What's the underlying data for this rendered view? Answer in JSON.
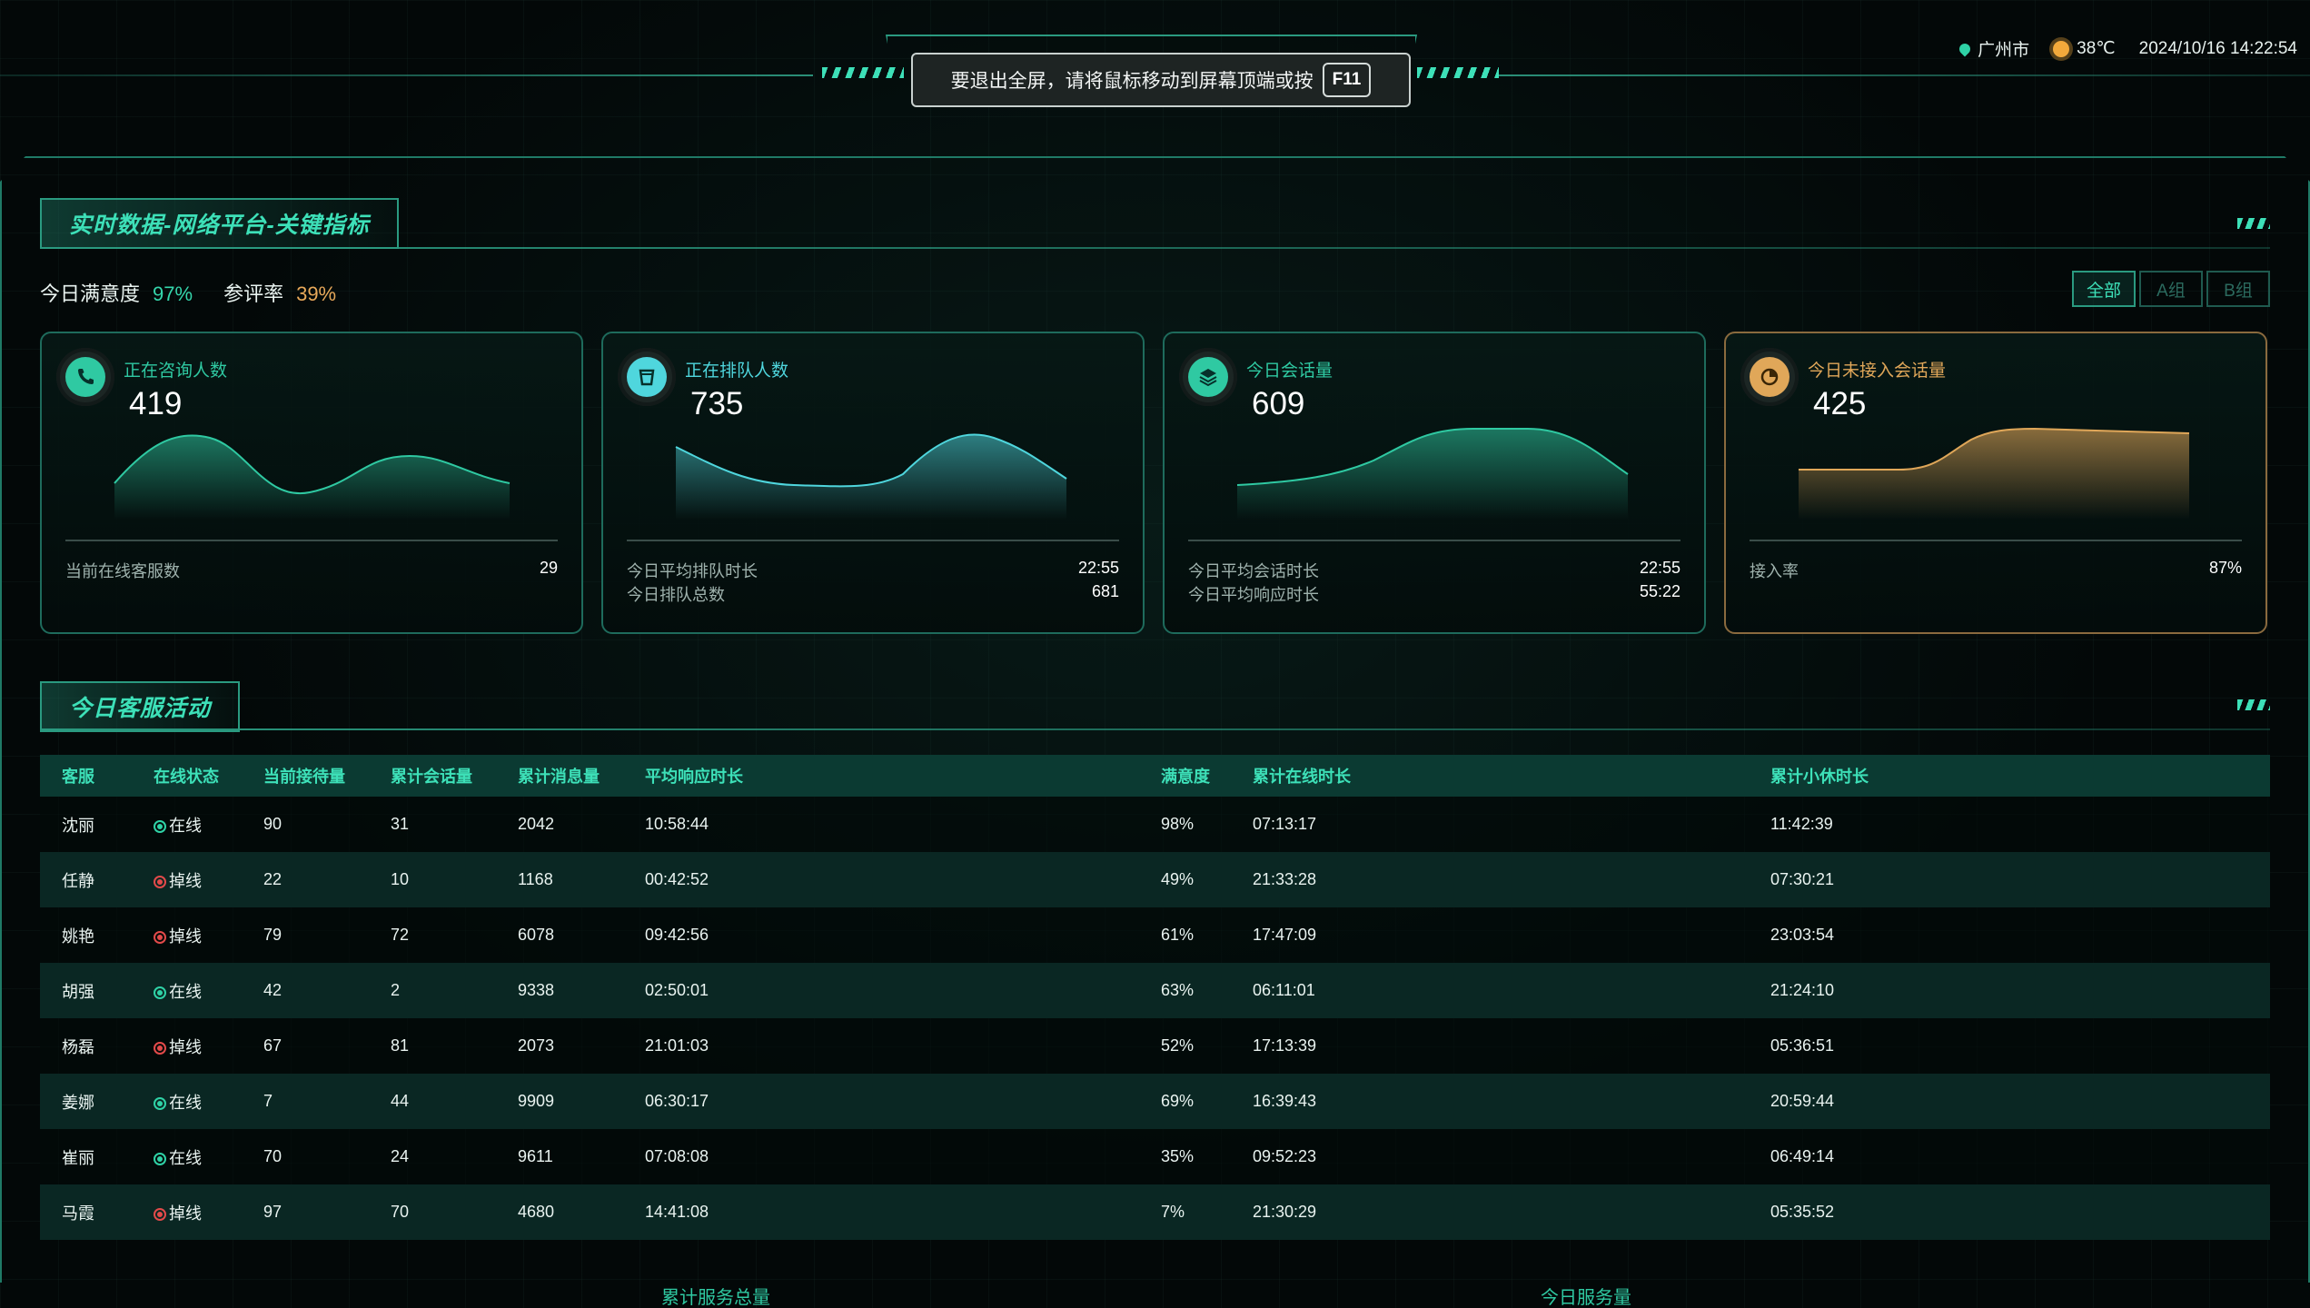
{
  "header": {
    "fullscreen_message": "要退出全屏，请将鼠标移动到屏幕顶端或按",
    "fullscreen_key": "F11",
    "location": "广州市",
    "temperature": "38℃",
    "datetime": "2024/10/16 14:22:54"
  },
  "section1": {
    "title": "实时数据-网络平台-关键指标",
    "satisfaction_label": "今日满意度",
    "satisfaction_value": "97%",
    "review_rate_label": "参评率",
    "review_rate_value": "39%",
    "filters": [
      "全部",
      "A组",
      "B组"
    ],
    "active_filter": "全部"
  },
  "cards": [
    {
      "label": "正在咨询人数",
      "value": "419",
      "accent": "#2fc9a2",
      "icon": "phone-icon",
      "rows": [
        {
          "label": "当前在线客服数",
          "value": "29"
        }
      ]
    },
    {
      "label": "正在排队人数",
      "value": "735",
      "accent": "#4fd6dd",
      "icon": "cup-icon",
      "rows": [
        {
          "label": "今日平均排队时长",
          "value": "22:55"
        },
        {
          "label": "今日排队总数",
          "value": "681"
        }
      ]
    },
    {
      "label": "今日会话量",
      "value": "609",
      "accent": "#2fc9a2",
      "icon": "layers-icon",
      "rows": [
        {
          "label": "今日平均会话时长",
          "value": "22:55"
        },
        {
          "label": "今日平均响应时长",
          "value": "55:22"
        }
      ]
    },
    {
      "label": "今日未接入会话量",
      "value": "425",
      "accent": "#e0a759",
      "icon": "pie-icon",
      "rows": [
        {
          "label": "接入率",
          "value": "87%"
        }
      ]
    }
  ],
  "section2": {
    "title": "今日客服活动",
    "columns": [
      "客服",
      "在线状态",
      "当前接待量",
      "累计会话量",
      "累计消息量",
      "平均响应时长",
      "满意度",
      "累计在线时长",
      "累计小休时长"
    ],
    "rows": [
      [
        "沈丽",
        "在线",
        "90",
        "31",
        "2042",
        "10:58:44",
        "98%",
        "07:13:17",
        "11:42:39"
      ],
      [
        "任静",
        "掉线",
        "22",
        "10",
        "1168",
        "00:42:52",
        "49%",
        "21:33:28",
        "07:30:21"
      ],
      [
        "姚艳",
        "掉线",
        "79",
        "72",
        "6078",
        "09:42:56",
        "61%",
        "17:47:09",
        "23:03:54"
      ],
      [
        "胡强",
        "在线",
        "42",
        "2",
        "9338",
        "02:50:01",
        "63%",
        "06:11:01",
        "21:24:10"
      ],
      [
        "杨磊",
        "掉线",
        "67",
        "81",
        "2073",
        "21:01:03",
        "52%",
        "17:13:39",
        "05:36:51"
      ],
      [
        "姜娜",
        "在线",
        "7",
        "44",
        "9909",
        "06:30:17",
        "69%",
        "16:39:43",
        "20:59:44"
      ],
      [
        "崔丽",
        "在线",
        "70",
        "24",
        "9611",
        "07:08:08",
        "35%",
        "09:52:23",
        "06:49:14"
      ],
      [
        "马霞",
        "掉线",
        "97",
        "70",
        "4680",
        "14:41:08",
        "7%",
        "21:30:29",
        "05:35:52"
      ]
    ]
  },
  "footer": {
    "total_service_label": "累计服务总量",
    "today_service_label": "今日服务量"
  }
}
